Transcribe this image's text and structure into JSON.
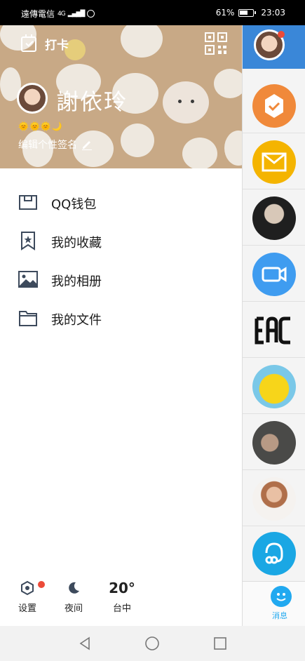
{
  "status_bar": {
    "carrier": "遠傳電信",
    "network": "4G",
    "battery": "61%",
    "time": "23:03"
  },
  "header": {
    "checkin_label": "打卡",
    "nickname": "謝依玲",
    "levels": "🌞🌞🌞🌙",
    "signature_placeholder": "编辑个性签名"
  },
  "menu": {
    "items": [
      {
        "label": "QQ钱包",
        "icon": "wallet-icon"
      },
      {
        "label": "我的收藏",
        "icon": "bookmark-star-icon"
      },
      {
        "label": "我的相册",
        "icon": "image-icon"
      },
      {
        "label": "我的文件",
        "icon": "folder-icon"
      }
    ]
  },
  "bottom_bar": {
    "settings_label": "设置",
    "night_label": "夜间",
    "weather_temp": "20°",
    "weather_city": "台中"
  },
  "background_page": {
    "tab_label": "消息"
  },
  "colors": {
    "header_bg": "#c8a986",
    "accent_blue": "#3a87d8",
    "badge_red": "#ec4b39",
    "qq_blue": "#21a9f0"
  }
}
